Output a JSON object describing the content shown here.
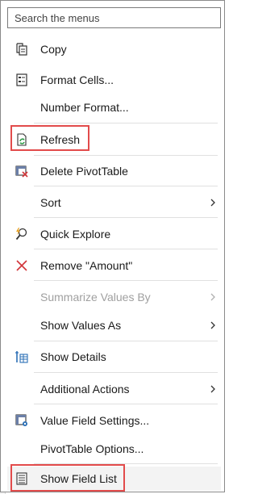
{
  "search": {
    "placeholder": "Search the menus"
  },
  "menu": {
    "items": [
      {
        "label": "Copy",
        "icon": "copy-icon"
      },
      {
        "label": "Format Cells...",
        "icon": "format-cells-icon"
      },
      {
        "label": "Number Format...",
        "icon": ""
      },
      {
        "label": "Refresh",
        "icon": "refresh-icon"
      },
      {
        "label": "Delete PivotTable",
        "icon": "delete-pivot-icon"
      },
      {
        "label": "Sort",
        "icon": ""
      },
      {
        "label": "Quick Explore",
        "icon": "quick-explore-icon"
      },
      {
        "label": "Remove \"Amount\"",
        "icon": "remove-x-icon"
      },
      {
        "label": "Summarize Values By",
        "icon": ""
      },
      {
        "label": "Show Values As",
        "icon": ""
      },
      {
        "label": "Show Details",
        "icon": "show-details-icon"
      },
      {
        "label": "Additional Actions",
        "icon": ""
      },
      {
        "label": "Value Field Settings...",
        "icon": "value-field-settings-icon"
      },
      {
        "label": "PivotTable Options...",
        "icon": ""
      },
      {
        "label": "Show Field List",
        "icon": "field-list-icon"
      }
    ]
  },
  "colors": {
    "highlight_border": "#e24b4b",
    "refresh_green": "#2e9b48",
    "remove_red": "#d13438",
    "icon_blue": "#2b6fb6"
  }
}
